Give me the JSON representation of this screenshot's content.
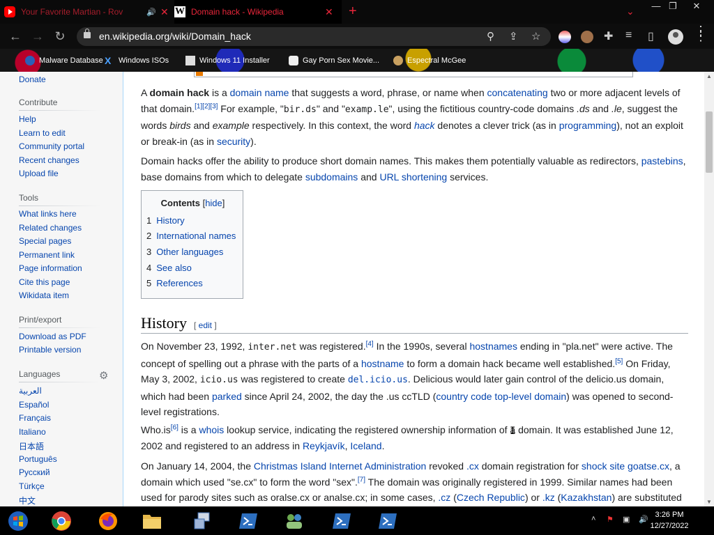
{
  "browser": {
    "tabs": [
      {
        "title": "Your Favorite Martian - Rov",
        "close": "✕"
      },
      {
        "title": "Domain hack - Wikipedia",
        "close": "✕"
      }
    ],
    "new_tab": "+",
    "url": "en.wikipedia.org/wiki/Domain_hack",
    "bookmarks": [
      "Malware Database",
      "Windows ISOs",
      "Windows 11 Installer",
      "Gay Porn Sex Movie...",
      "Espectral McGee"
    ]
  },
  "sidebar": {
    "top_link": "Donate",
    "sections": [
      {
        "heading": "Contribute",
        "links": [
          "Help",
          "Learn to edit",
          "Community portal",
          "Recent changes",
          "Upload file"
        ]
      },
      {
        "heading": "Tools",
        "links": [
          "What links here",
          "Related changes",
          "Special pages",
          "Permanent link",
          "Page information",
          "Cite this page",
          "Wikidata item"
        ]
      },
      {
        "heading": "Print/export",
        "links": [
          "Download as PDF",
          "Printable version"
        ]
      }
    ],
    "languages_heading": "Languages",
    "languages": [
      "العربية",
      "Español",
      "Français",
      "Italiano",
      "日本語",
      "Português",
      "Русский",
      "Türkçe",
      "中文"
    ]
  },
  "article": {
    "toc": {
      "title": "Contents",
      "hide": "hide",
      "items": [
        {
          "num": "1",
          "label": "History"
        },
        {
          "num": "2",
          "label": "International names"
        },
        {
          "num": "3",
          "label": "Other languages"
        },
        {
          "num": "4",
          "label": "See also"
        },
        {
          "num": "5",
          "label": "References"
        }
      ]
    },
    "history_heading": "History",
    "edit_label": "edit"
  },
  "taskbar": {
    "time": "3:26 PM",
    "date": "12/27/2022"
  }
}
